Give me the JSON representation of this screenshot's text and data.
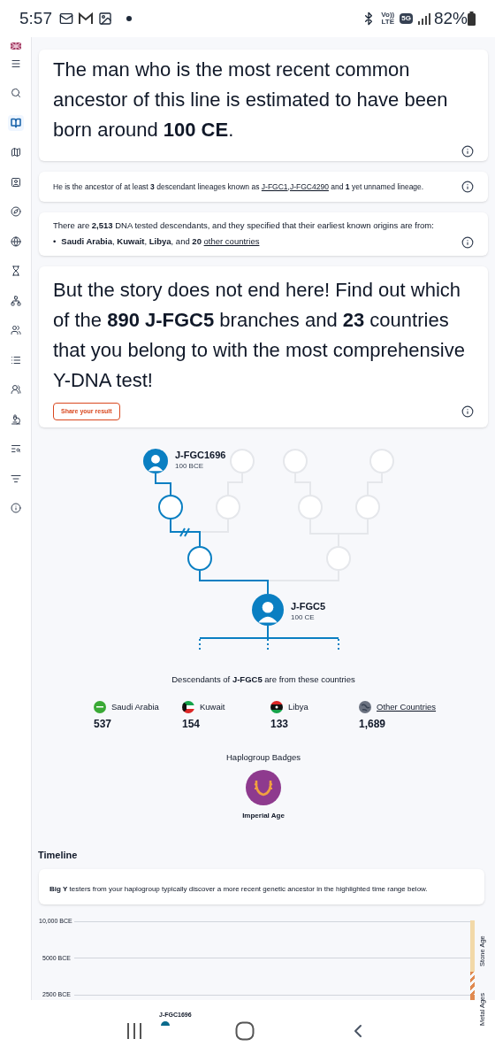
{
  "status_bar": {
    "time": "5:57",
    "volte": "Vo))",
    "lte": "LTE",
    "network": "5G",
    "battery": "82%"
  },
  "sidebar": {
    "items": [
      {
        "selected": false
      },
      {
        "selected": false
      },
      {
        "selected": true
      },
      {
        "selected": false
      },
      {
        "selected": false
      },
      {
        "selected": false
      },
      {
        "selected": false
      },
      {
        "selected": false
      },
      {
        "selected": false
      },
      {
        "selected": false
      },
      {
        "selected": false
      },
      {
        "selected": false
      },
      {
        "selected": false
      },
      {
        "selected": false
      },
      {
        "selected": false
      },
      {
        "selected": false
      }
    ]
  },
  "ancestor_card": {
    "text": "The man who is the most recent common ancestor of this line is estimated to have been born around **100 CE**."
  },
  "lineage_card": {
    "parts": [
      {
        "kind": "text",
        "text": "He is the ancestor of at least **3** descendant lineages known as"
      },
      {
        "kind": "link",
        "text": "J-FGC1"
      },
      {
        "kind": "text",
        "text": ","
      },
      {
        "kind": "link",
        "text": "J-FGC4290"
      },
      {
        "kind": "text",
        "text": "and **1** yet unnamed lineage."
      }
    ]
  },
  "descendants_card": {
    "text": "There are **2,513** DNA tested descendants, and they specified that their earliest known origins are from:",
    "bullet": "•",
    "origins": "**Saudi Arabia**, **Kuwait**, **Libya**, and **20**",
    "link": "other countries"
  },
  "promo_card": {
    "text": "But the story does not end here! Find out which of the **890 J-FGC5** branches and **23** countries that you belong to with the most comprehensive Y-DNA test!",
    "button": "Share your result"
  },
  "tree": {
    "ancestor": {
      "name": "J-FGC1696",
      "date": "100 BCE"
    },
    "current": {
      "name": "J-FGC5",
      "date": "100 CE"
    }
  },
  "countries": {
    "caption": "Descendants of **J-FGC5** are from these countries",
    "items": [
      {
        "kind": "country",
        "name": "Saudi Arabia",
        "count": "537"
      },
      {
        "kind": "country",
        "name": "Kuwait",
        "count": "154"
      },
      {
        "kind": "country",
        "name": "Libya",
        "count": "133"
      },
      {
        "kind": "link",
        "name": "Other Countries",
        "count": "1,689"
      }
    ]
  },
  "badges": {
    "title": "Haplogroup Badges",
    "items": [
      {
        "name": "Imperial Age"
      }
    ]
  },
  "timeline": {
    "title": "Timeline",
    "note": "**Big Y** testers from your haplogroup typically discover a more recent genetic ancestor in the highlighted time range below.",
    "ticks": [
      "10,000 BCE",
      "5000 BCE",
      "2500 BCE"
    ],
    "eras": [
      "Stone Age",
      "Metal Ages"
    ],
    "marker": "J-FGC1696"
  }
}
